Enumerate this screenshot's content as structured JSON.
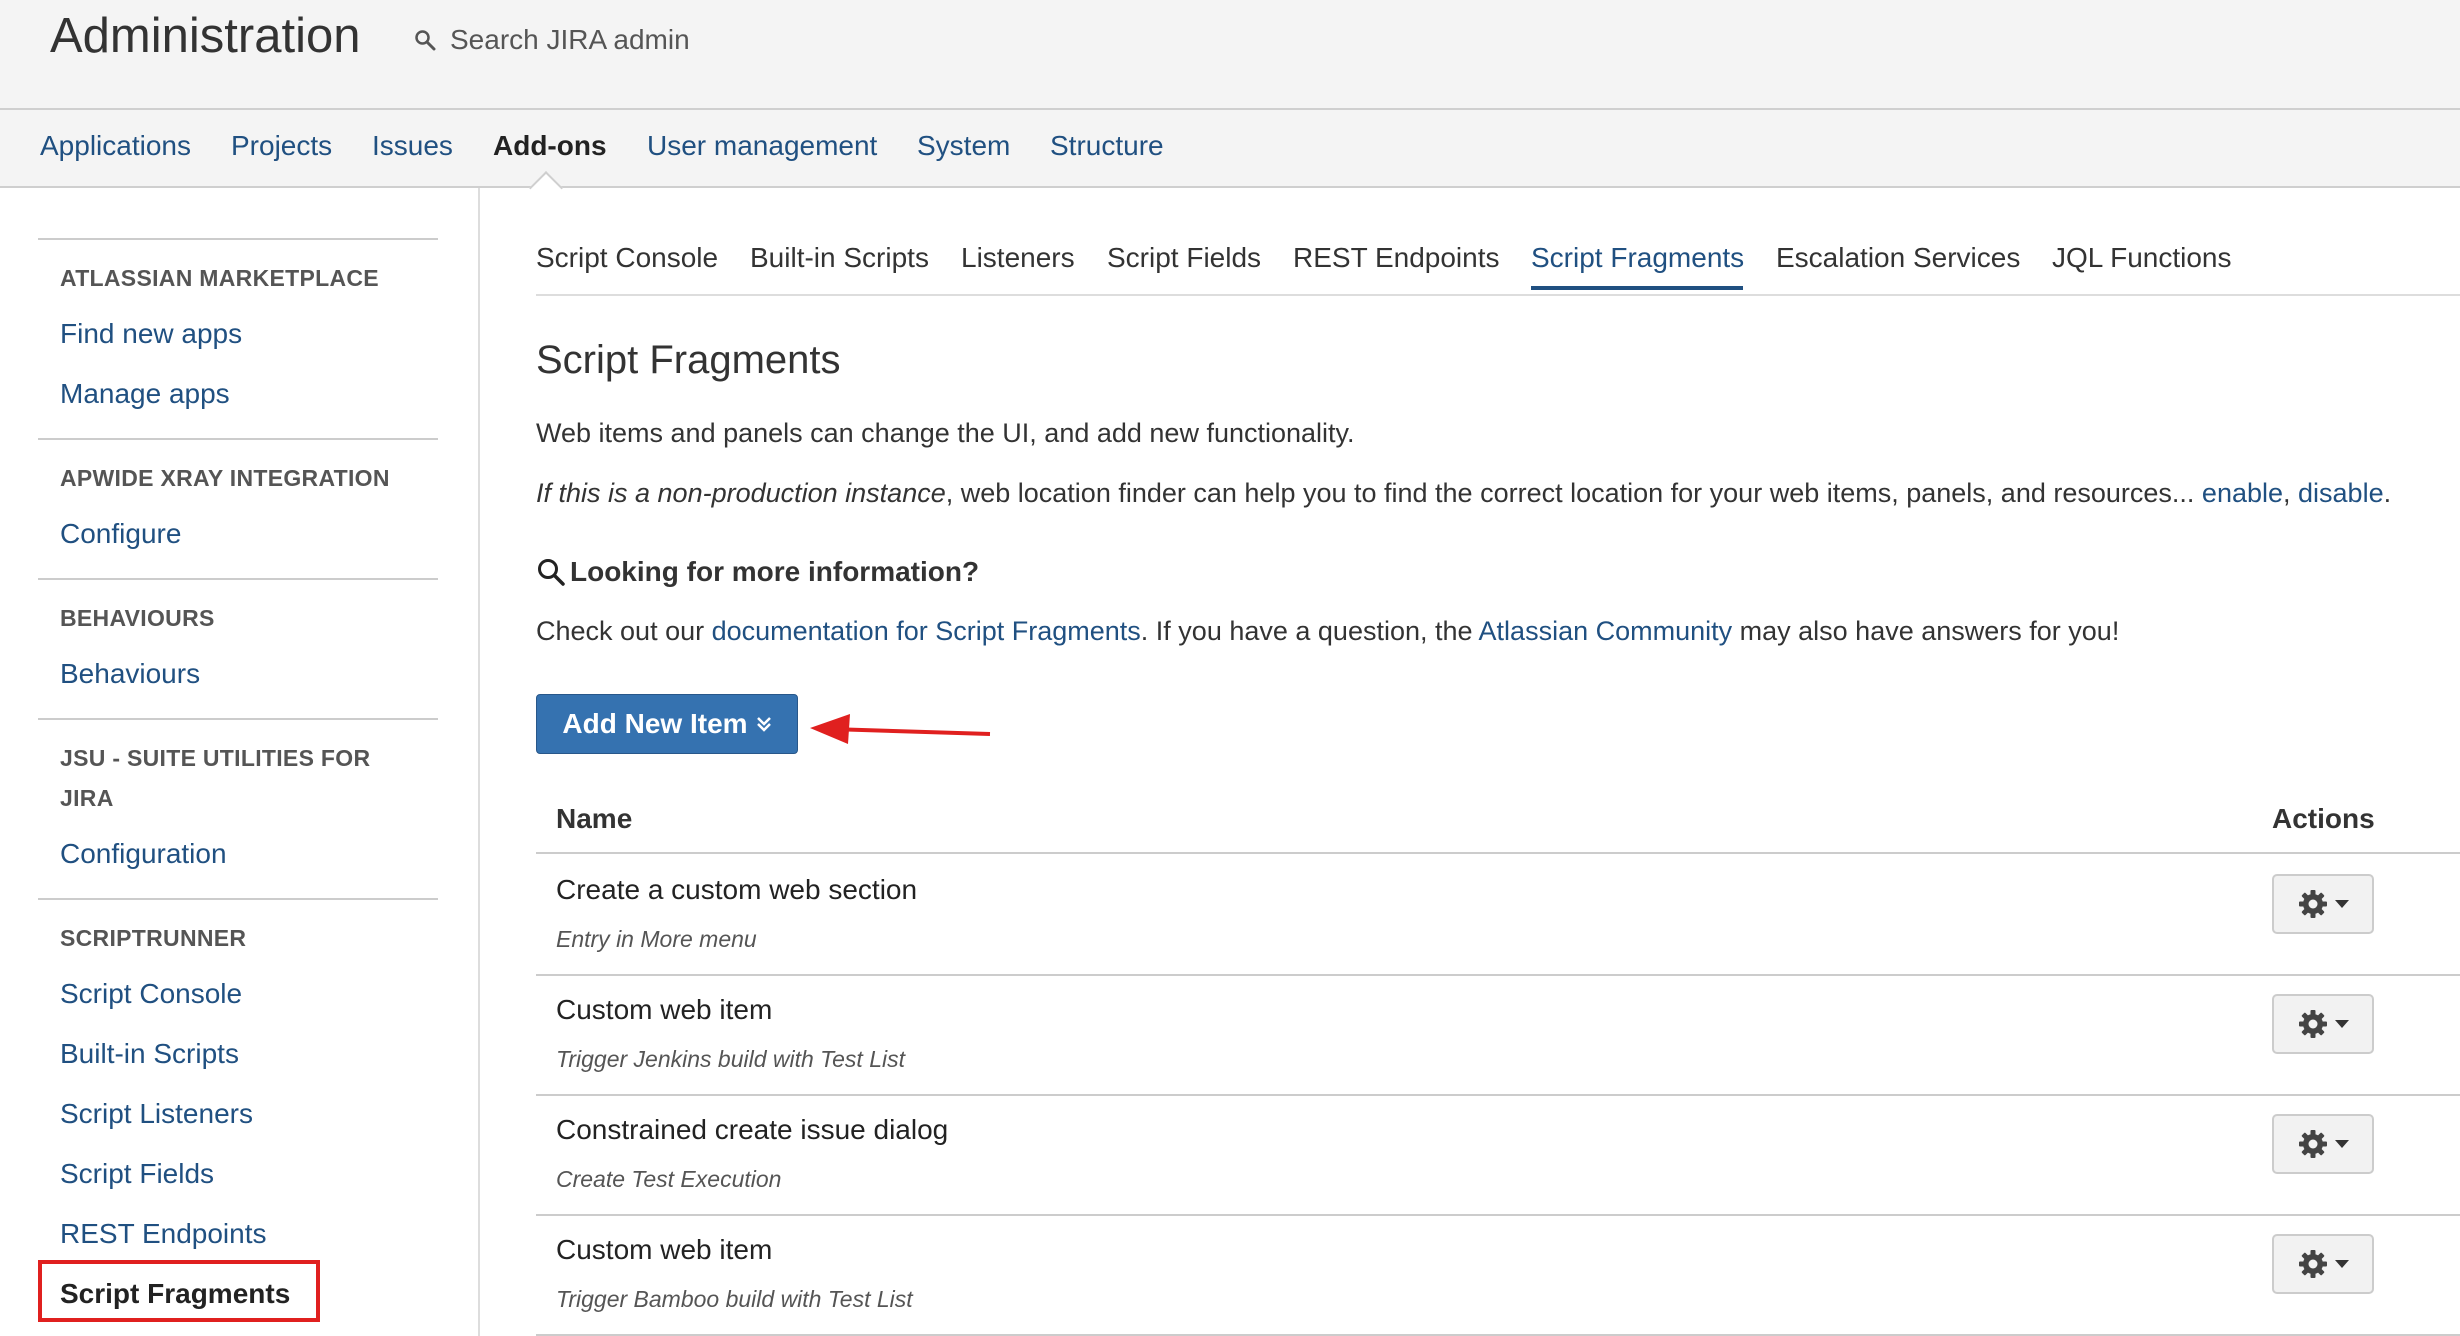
{
  "header": {
    "title": "Administration",
    "search_label": "Search JIRA admin"
  },
  "topnav": {
    "items": [
      "Applications",
      "Projects",
      "Issues",
      "Add-ons",
      "User management",
      "System",
      "Structure"
    ],
    "active": "Add-ons"
  },
  "sidebar": {
    "sections": [
      {
        "heading": "ATLASSIAN MARKETPLACE",
        "links": [
          "Find new apps",
          "Manage apps"
        ]
      },
      {
        "heading": "APWIDE XRAY INTEGRATION",
        "links": [
          "Configure"
        ]
      },
      {
        "heading": "BEHAVIOURS",
        "links": [
          "Behaviours"
        ]
      },
      {
        "heading": "JSU - SUITE UTILITIES FOR JIRA",
        "links": [
          "Configuration"
        ]
      },
      {
        "heading": "SCRIPTRUNNER",
        "links": [
          "Script Console",
          "Built-in Scripts",
          "Script Listeners",
          "Script Fields",
          "REST Endpoints",
          "Script Fragments"
        ]
      }
    ],
    "active": "Script Fragments"
  },
  "subtabs": {
    "items": [
      "Script Console",
      "Built-in Scripts",
      "Listeners",
      "Script Fields",
      "REST Endpoints",
      "Script Fragments",
      "Escalation Services",
      "JQL Functions"
    ],
    "active": "Script Fragments"
  },
  "main": {
    "title": "Script Fragments",
    "intro": "Web items and panels can change the UI, and add new functionality.",
    "finder": {
      "italic": "If this is a non-production instance",
      "text": ", web location finder can help you to find the correct location for your web items, panels, and resources... ",
      "enable": "enable",
      "sep": ", ",
      "disable": "disable",
      "end": "."
    },
    "info_heading": "Looking for more information?",
    "info": {
      "pre": "Check out our ",
      "doc_link": "documentation for Script Fragments",
      "mid": ". If you have a question, the ",
      "community_link": "Atlassian Community",
      "post": " may also have answers for you!"
    },
    "add_button": "Add New Item",
    "table": {
      "col_name": "Name",
      "col_actions": "Actions",
      "rows": [
        {
          "name": "Create a custom web section",
          "desc": "Entry in More menu"
        },
        {
          "name": "Custom web item",
          "desc": "Trigger Jenkins build with Test List"
        },
        {
          "name": "Constrained create issue dialog",
          "desc": "Create Test Execution"
        },
        {
          "name": "Custom web item",
          "desc": "Trigger Bamboo build with Test List"
        }
      ]
    }
  },
  "colors": {
    "link": "#205081",
    "button": "#3572b0",
    "highlight": "#e0201f"
  }
}
